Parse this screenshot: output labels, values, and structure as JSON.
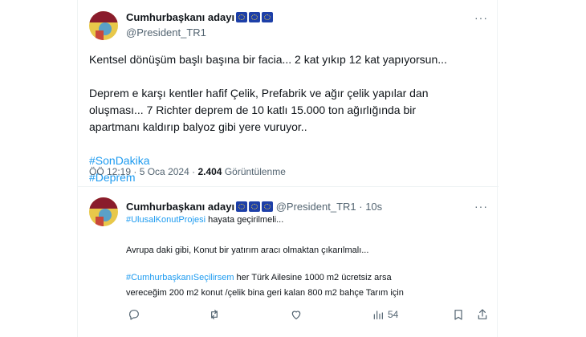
{
  "tweet": {
    "display_name": "Cumhurbaşkanı adayı",
    "handle": "@President_TR1",
    "more_label": "···",
    "line1": "Kentsel dönüşüm başlı başına bir facia... 2 kat yıkıp 12 kat yapıyorsun...",
    "para2": "Deprem e karşı kentler hafif Çelik, Prefabrik ve ağır çelik yapılar dan\noluşması... 7 Richter deprem de 10 katlı 15.000 ton ağırlığında bir\napartmanı kaldırıp balyoz gibi yere vuruyor..",
    "hashtag1": "#SonDakika",
    "hashtag2": "#Deprem",
    "time": "ÖÖ 12:19",
    "sep": "·",
    "date": "5 Oca 2024",
    "views_count": "2.404",
    "views_label": "Görüntülenme"
  },
  "reply": {
    "display_name": "Cumhurbaşkanı adayı",
    "handle": "@President_TR1",
    "time": "· 10s",
    "more_label": "···",
    "l1_tag": "#UlusalKonutProjesi",
    "l1_rest": " hayata geçirilmeli...",
    "l2": "Avrupa daki gibi, Konut bir yatırım aracı olmaktan çıkarılmalı...",
    "l3_tag": "#CumhurbaşkanıSeçilirsem",
    "l3_rest": " her Türk Ailesine 1000 m2 ücretsiz arsa",
    "l4": "vereceğim 200 m2 konut /çelik bina geri kalan 800 m2 bahçe Tarım için"
  },
  "actions": {
    "reply_icon": "reply-icon",
    "retweet_icon": "retweet-icon",
    "like_icon": "heart-icon",
    "views_icon": "views-icon",
    "views_count": "54",
    "bookmark_icon": "bookmark-icon",
    "share_icon": "share-icon"
  },
  "colors": {
    "link": "#1d9bf0",
    "secondary_text": "#536471",
    "divider": "#eff3f4"
  }
}
